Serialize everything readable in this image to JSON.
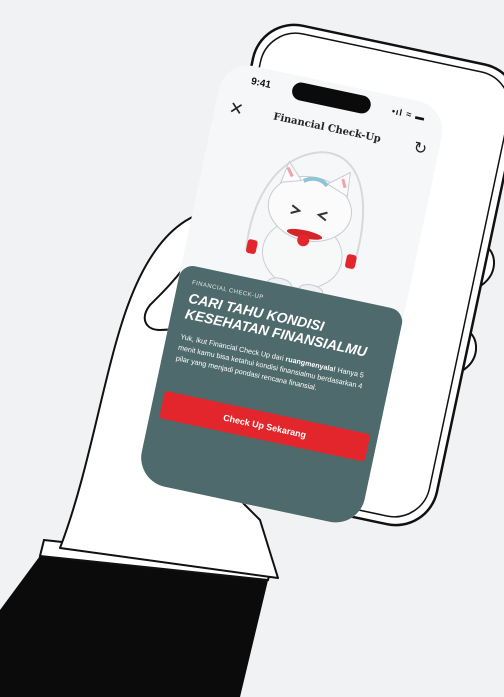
{
  "statusbar": {
    "time": "9:41",
    "icons": "•ıl ≈ ▬"
  },
  "appbar": {
    "title": "Financial Check-Up",
    "close_icon": "close-icon",
    "refresh_icon": "refresh-icon"
  },
  "card": {
    "eyebrow": "FINANCIAL CHECK-UP",
    "headline": "CARI TAHU KONDISI KESEHATAN FINANSIALMU",
    "body_prefix": "Yuk, ikut Financial Check Up dari ",
    "body_bold": "ruangmenyala!",
    "body_suffix": " Hanya 5 menit kamu bisa ketahui kondisi finansialmu berdasarkan 4 pilar yang menjadi pondasi rencana finansial.",
    "cta": "Check Up Sekarang"
  },
  "colors": {
    "card_bg": "#4e6a6c",
    "cta_bg": "#e3262b",
    "page_bg": "#f1f2f4"
  }
}
